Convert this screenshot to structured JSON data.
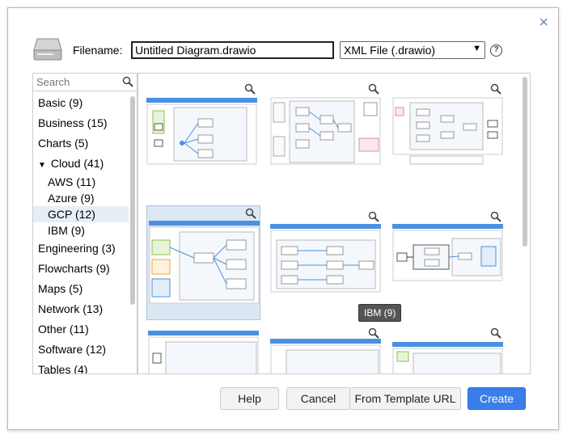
{
  "dialog": {
    "close_glyph": "×",
    "filename_label": "Filename:",
    "filename_value": "Untitled Diagram.drawio",
    "format_selected": "XML File (.drawio)",
    "help_glyph": "?",
    "search_placeholder": "Search",
    "tooltip": "IBM (9)"
  },
  "categories": [
    {
      "label": "Basic (9)"
    },
    {
      "label": "Business (15)"
    },
    {
      "label": "Charts (5)"
    },
    {
      "label": "Cloud (41)",
      "expanded": true
    },
    {
      "label": "AWS (11)",
      "sub": true
    },
    {
      "label": "Azure (9)",
      "sub": true
    },
    {
      "label": "GCP (12)",
      "sub": true,
      "selected": true
    },
    {
      "label": "IBM (9)",
      "sub": true
    },
    {
      "label": "Engineering (3)"
    },
    {
      "label": "Flowcharts (9)"
    },
    {
      "label": "Maps (5)"
    },
    {
      "label": "Network (13)"
    },
    {
      "label": "Other (11)"
    },
    {
      "label": "Software (12)"
    },
    {
      "label": "Tables (4)"
    }
  ],
  "buttons": {
    "help": "Help",
    "cancel": "Cancel",
    "from_template_url": "From Template URL",
    "create": "Create"
  },
  "icons": {
    "zoom": "zoom-icon",
    "search": "search-icon",
    "drive": "drive-icon",
    "expand": "triangle-down-icon"
  },
  "colors": {
    "accent": "#3b7ee9",
    "selection": "#dce7f4",
    "thumb_header": "#4a90e2"
  }
}
